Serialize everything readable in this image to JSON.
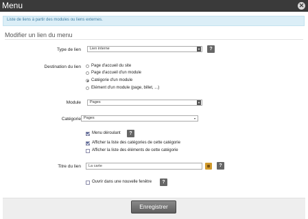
{
  "window": {
    "title": "Menu"
  },
  "info_text": "Liste de liens à partir des modules ou liens externes.",
  "section_title": "Modifier un lien du menu",
  "fields": {
    "type_lien": {
      "label": "Type de lien",
      "value": "Lien interne"
    },
    "destination": {
      "label": "Destination du lien",
      "options": [
        {
          "label": "Page d'accueil du site",
          "selected": false
        },
        {
          "label": "Page d'accueil d'un module",
          "selected": false
        },
        {
          "label": "Catégorie d'un module",
          "selected": true
        },
        {
          "label": "Elément d'un module (page, billet, ...)",
          "selected": false
        }
      ]
    },
    "module": {
      "label": "Module",
      "value": "Pages"
    },
    "categorie": {
      "label": "Catégorie",
      "value": "Pages"
    },
    "checks": [
      {
        "label": "Menu déroulant",
        "checked": true
      },
      {
        "label": "Afficher la liste des catégories de cette catégorie",
        "checked": true
      },
      {
        "label": "Afficher la liste des éléments de cette catégorie",
        "checked": false
      }
    ],
    "titre": {
      "label": "Titre du lien",
      "value": "La carte"
    },
    "new_window": {
      "label": "Ouvrir dans une nouvelle fenêtre",
      "checked": false
    }
  },
  "help_glyph": "?",
  "footer": {
    "save_label": "Enregistrer"
  },
  "colors": {
    "titlebar": "#3a3a3a",
    "info_bg": "#dbeef7",
    "info_text": "#3d7ea3",
    "button": "#6f6f6f"
  }
}
